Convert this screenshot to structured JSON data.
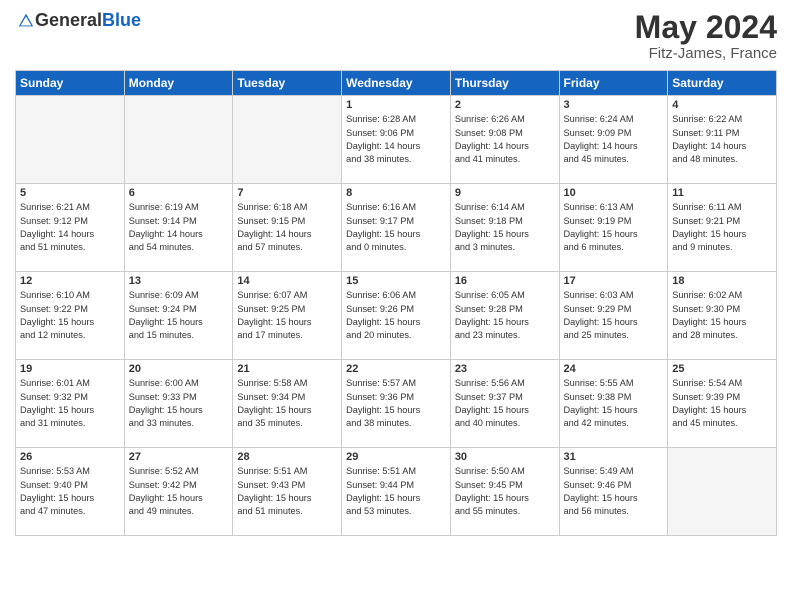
{
  "logo": {
    "general": "General",
    "blue": "Blue"
  },
  "title": "May 2024",
  "location": "Fitz-James, France",
  "headers": [
    "Sunday",
    "Monday",
    "Tuesday",
    "Wednesday",
    "Thursday",
    "Friday",
    "Saturday"
  ],
  "weeks": [
    [
      {
        "day": "",
        "info": ""
      },
      {
        "day": "",
        "info": ""
      },
      {
        "day": "",
        "info": ""
      },
      {
        "day": "1",
        "info": "Sunrise: 6:28 AM\nSunset: 9:06 PM\nDaylight: 14 hours\nand 38 minutes."
      },
      {
        "day": "2",
        "info": "Sunrise: 6:26 AM\nSunset: 9:08 PM\nDaylight: 14 hours\nand 41 minutes."
      },
      {
        "day": "3",
        "info": "Sunrise: 6:24 AM\nSunset: 9:09 PM\nDaylight: 14 hours\nand 45 minutes."
      },
      {
        "day": "4",
        "info": "Sunrise: 6:22 AM\nSunset: 9:11 PM\nDaylight: 14 hours\nand 48 minutes."
      }
    ],
    [
      {
        "day": "5",
        "info": "Sunrise: 6:21 AM\nSunset: 9:12 PM\nDaylight: 14 hours\nand 51 minutes."
      },
      {
        "day": "6",
        "info": "Sunrise: 6:19 AM\nSunset: 9:14 PM\nDaylight: 14 hours\nand 54 minutes."
      },
      {
        "day": "7",
        "info": "Sunrise: 6:18 AM\nSunset: 9:15 PM\nDaylight: 14 hours\nand 57 minutes."
      },
      {
        "day": "8",
        "info": "Sunrise: 6:16 AM\nSunset: 9:17 PM\nDaylight: 15 hours\nand 0 minutes."
      },
      {
        "day": "9",
        "info": "Sunrise: 6:14 AM\nSunset: 9:18 PM\nDaylight: 15 hours\nand 3 minutes."
      },
      {
        "day": "10",
        "info": "Sunrise: 6:13 AM\nSunset: 9:19 PM\nDaylight: 15 hours\nand 6 minutes."
      },
      {
        "day": "11",
        "info": "Sunrise: 6:11 AM\nSunset: 9:21 PM\nDaylight: 15 hours\nand 9 minutes."
      }
    ],
    [
      {
        "day": "12",
        "info": "Sunrise: 6:10 AM\nSunset: 9:22 PM\nDaylight: 15 hours\nand 12 minutes."
      },
      {
        "day": "13",
        "info": "Sunrise: 6:09 AM\nSunset: 9:24 PM\nDaylight: 15 hours\nand 15 minutes."
      },
      {
        "day": "14",
        "info": "Sunrise: 6:07 AM\nSunset: 9:25 PM\nDaylight: 15 hours\nand 17 minutes."
      },
      {
        "day": "15",
        "info": "Sunrise: 6:06 AM\nSunset: 9:26 PM\nDaylight: 15 hours\nand 20 minutes."
      },
      {
        "day": "16",
        "info": "Sunrise: 6:05 AM\nSunset: 9:28 PM\nDaylight: 15 hours\nand 23 minutes."
      },
      {
        "day": "17",
        "info": "Sunrise: 6:03 AM\nSunset: 9:29 PM\nDaylight: 15 hours\nand 25 minutes."
      },
      {
        "day": "18",
        "info": "Sunrise: 6:02 AM\nSunset: 9:30 PM\nDaylight: 15 hours\nand 28 minutes."
      }
    ],
    [
      {
        "day": "19",
        "info": "Sunrise: 6:01 AM\nSunset: 9:32 PM\nDaylight: 15 hours\nand 31 minutes."
      },
      {
        "day": "20",
        "info": "Sunrise: 6:00 AM\nSunset: 9:33 PM\nDaylight: 15 hours\nand 33 minutes."
      },
      {
        "day": "21",
        "info": "Sunrise: 5:58 AM\nSunset: 9:34 PM\nDaylight: 15 hours\nand 35 minutes."
      },
      {
        "day": "22",
        "info": "Sunrise: 5:57 AM\nSunset: 9:36 PM\nDaylight: 15 hours\nand 38 minutes."
      },
      {
        "day": "23",
        "info": "Sunrise: 5:56 AM\nSunset: 9:37 PM\nDaylight: 15 hours\nand 40 minutes."
      },
      {
        "day": "24",
        "info": "Sunrise: 5:55 AM\nSunset: 9:38 PM\nDaylight: 15 hours\nand 42 minutes."
      },
      {
        "day": "25",
        "info": "Sunrise: 5:54 AM\nSunset: 9:39 PM\nDaylight: 15 hours\nand 45 minutes."
      }
    ],
    [
      {
        "day": "26",
        "info": "Sunrise: 5:53 AM\nSunset: 9:40 PM\nDaylight: 15 hours\nand 47 minutes."
      },
      {
        "day": "27",
        "info": "Sunrise: 5:52 AM\nSunset: 9:42 PM\nDaylight: 15 hours\nand 49 minutes."
      },
      {
        "day": "28",
        "info": "Sunrise: 5:51 AM\nSunset: 9:43 PM\nDaylight: 15 hours\nand 51 minutes."
      },
      {
        "day": "29",
        "info": "Sunrise: 5:51 AM\nSunset: 9:44 PM\nDaylight: 15 hours\nand 53 minutes."
      },
      {
        "day": "30",
        "info": "Sunrise: 5:50 AM\nSunset: 9:45 PM\nDaylight: 15 hours\nand 55 minutes."
      },
      {
        "day": "31",
        "info": "Sunrise: 5:49 AM\nSunset: 9:46 PM\nDaylight: 15 hours\nand 56 minutes."
      },
      {
        "day": "",
        "info": ""
      }
    ]
  ]
}
